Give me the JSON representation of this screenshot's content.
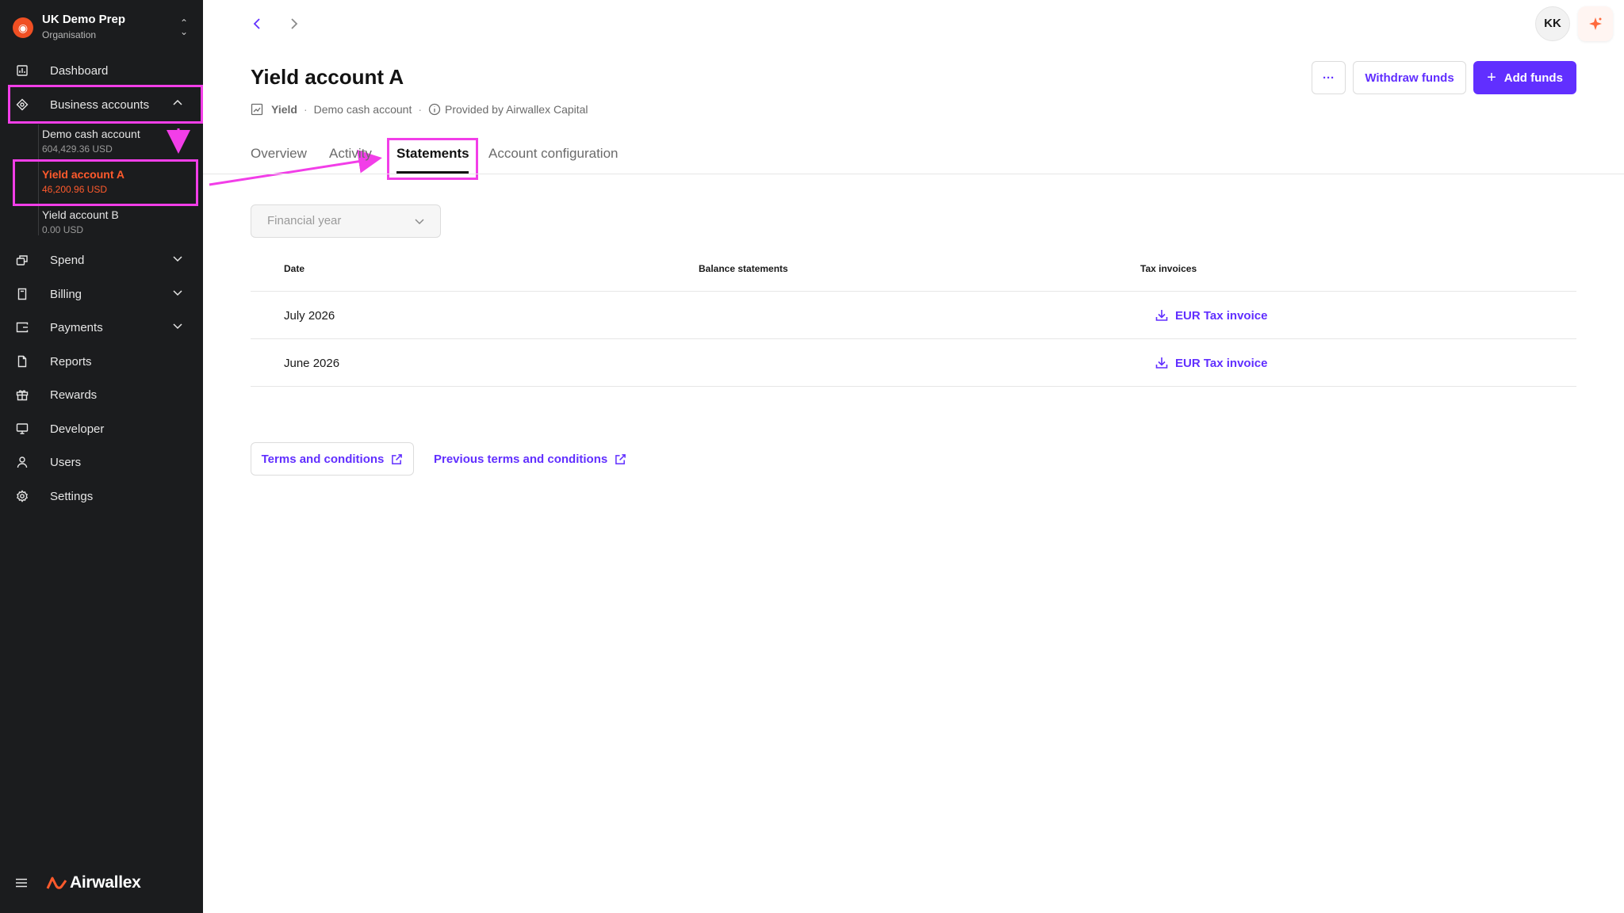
{
  "org": {
    "name": "UK Demo Prep",
    "subtitle": "Organisation"
  },
  "sidebar": {
    "items": [
      {
        "label": "Dashboard",
        "icon": "dashboard-icon"
      },
      {
        "label": "Business accounts",
        "icon": "business-accounts-icon",
        "expanded": true
      },
      {
        "label": "Spend",
        "icon": "spend-icon"
      },
      {
        "label": "Billing",
        "icon": "billing-icon"
      },
      {
        "label": "Payments",
        "icon": "payments-icon"
      },
      {
        "label": "Reports",
        "icon": "reports-icon"
      },
      {
        "label": "Rewards",
        "icon": "rewards-icon"
      },
      {
        "label": "Developer",
        "icon": "developer-icon"
      },
      {
        "label": "Users",
        "icon": "users-icon"
      },
      {
        "label": "Settings",
        "icon": "settings-icon"
      }
    ],
    "sub_accounts": [
      {
        "name": "Demo cash account",
        "balance": "604,429.36 USD"
      },
      {
        "name": "Yield account A",
        "balance": "46,200.96 USD",
        "active": true
      },
      {
        "name": "Yield account B",
        "balance": "0.00 USD"
      }
    ],
    "brand": "Airwallex"
  },
  "topbar": {
    "avatar_initials": "KK"
  },
  "header": {
    "title": "Yield account A",
    "meta": {
      "type": "Yield",
      "linked": "Demo cash account",
      "provider": "Provided by Airwallex Capital"
    },
    "more_label": "···",
    "withdraw_label": "Withdraw funds",
    "add_label": "Add funds"
  },
  "tabs": [
    {
      "label": "Overview"
    },
    {
      "label": "Activity"
    },
    {
      "label": "Statements",
      "active": true
    },
    {
      "label": "Account configuration"
    }
  ],
  "filter": {
    "placeholder": "Financial year"
  },
  "table": {
    "headers": [
      "Date",
      "Balance statements",
      "Tax invoices"
    ],
    "rows": [
      {
        "date": "July 2026",
        "balance": "",
        "tax": "EUR Tax invoice"
      },
      {
        "date": "June 2026",
        "balance": "",
        "tax": "EUR Tax invoice"
      }
    ]
  },
  "links": {
    "terms": "Terms and conditions",
    "previous_terms": "Previous terms and conditions"
  },
  "colors": {
    "accent": "#612fff",
    "sidebar_bg": "#1b1c1e",
    "active": "#ff5a2c",
    "annotation": "#f23ee8"
  }
}
